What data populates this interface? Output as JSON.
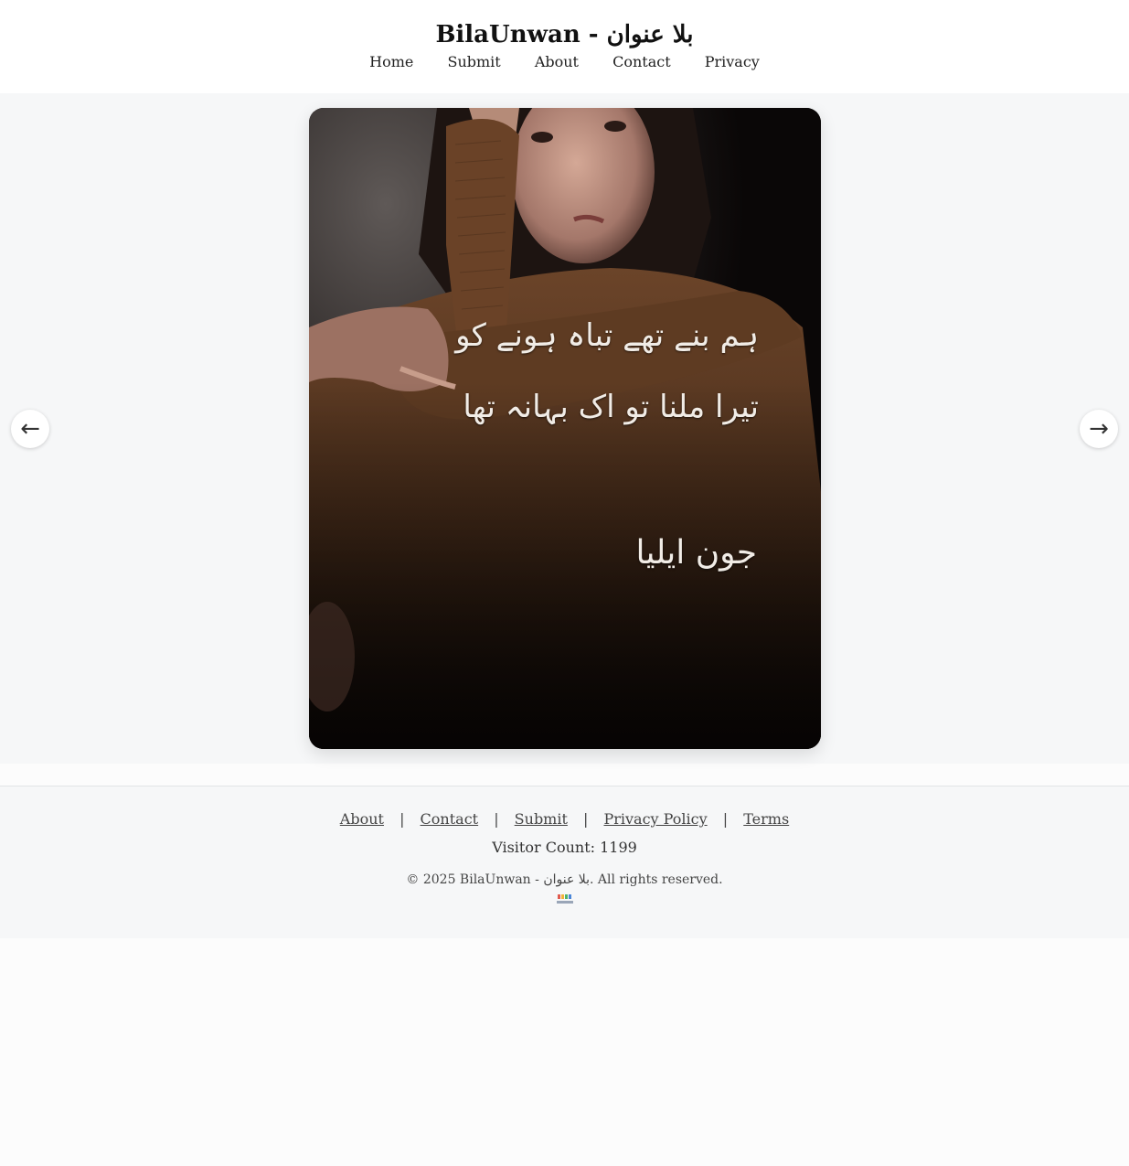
{
  "header": {
    "title": "BilaUnwan - بلا عنوان",
    "nav": [
      "Home",
      "Submit",
      "About",
      "Contact",
      "Privacy"
    ]
  },
  "slider": {
    "poem_line_1": "ہم بنے تھے تباہ ہونے کو",
    "poem_line_2": "تیرا ملنا تو اک بہانہ تھا",
    "poet": "جون ایلیا",
    "prev_icon": "←",
    "next_icon": "→"
  },
  "footer": {
    "links": [
      "About",
      "Contact",
      "Submit",
      "Privacy Policy",
      "Terms"
    ],
    "separator": "|",
    "visitor_count": "Visitor Count: 1199",
    "copyright": "© 2025 BilaUnwan - بلا عنوان. All rights reserved."
  },
  "colors": {
    "page_bg": "#fcfcfc",
    "band_bg": "#f6f7f8",
    "sweater": "#5a3a22",
    "poem_text": "#f1ece6"
  },
  "icons": {
    "prev": "arrow-left-icon",
    "next": "arrow-right-icon",
    "footer_logo": "site-logo-icon"
  }
}
